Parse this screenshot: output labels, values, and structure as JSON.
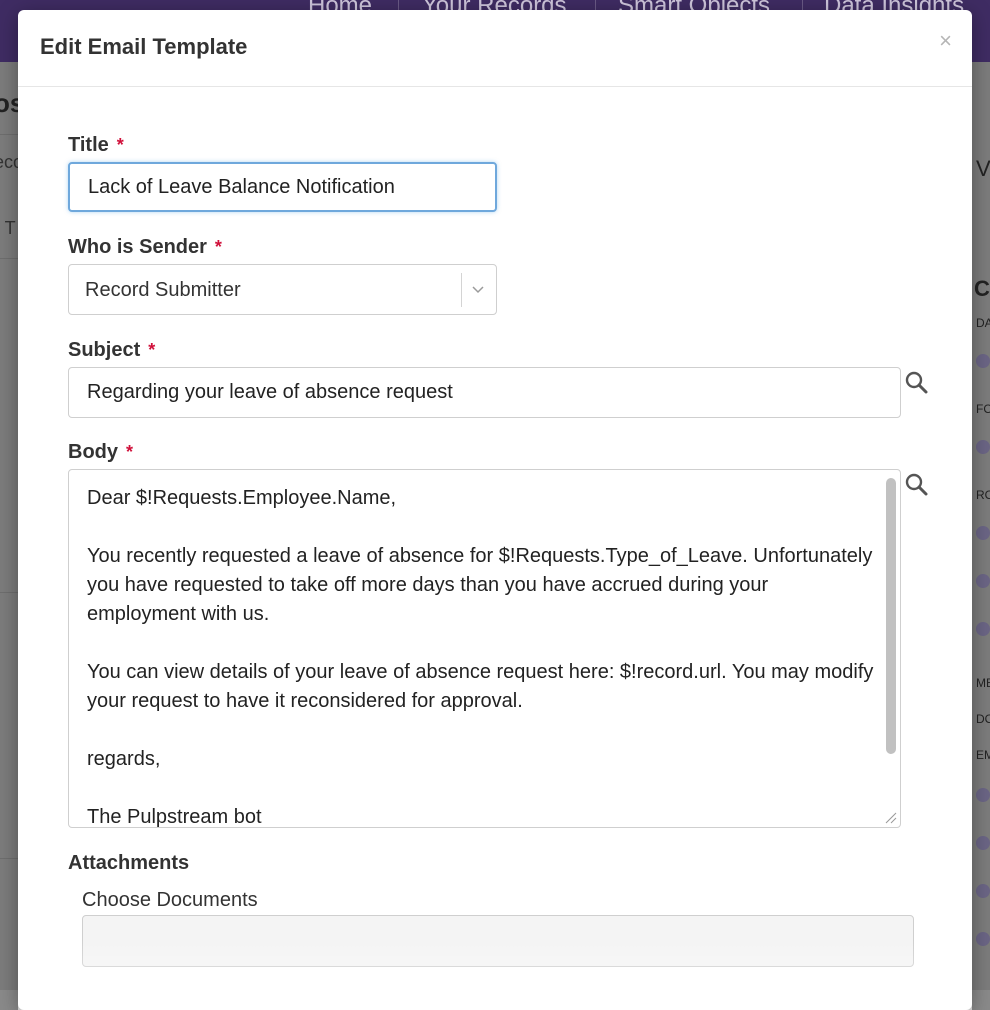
{
  "background": {
    "nav_items": [
      "Home",
      "Your Records",
      "Smart Objects",
      "Data Insights"
    ],
    "fragments": [
      "os",
      "eco",
      "r T",
      "V",
      "Co",
      "DA",
      "FO",
      "RO",
      "ME",
      "DO",
      "EM"
    ]
  },
  "modal": {
    "title": "Edit Email Template",
    "close_symbol": "×",
    "required_marker": "*",
    "fields": {
      "title": {
        "label": "Title",
        "value": "Lack of Leave Balance Notification"
      },
      "sender": {
        "label": "Who is Sender",
        "value": "Record Submitter"
      },
      "subject": {
        "label": "Subject",
        "value": "Regarding your leave of absence request"
      },
      "body": {
        "label": "Body",
        "paragraphs": [
          "Dear $!Requests.Employee.Name,",
          "You recently requested a leave of absence for $!Requests.Type_of_Leave. Unfortunately you have requested to take off more days than you have accrued during your employment with us.",
          "You can view details of your leave of absence request here: $!record.url. You may modify your request to have it reconsidered for approval.",
          "regards,",
          "The Pulpstream bot"
        ]
      }
    },
    "attachments": {
      "label": "Attachments",
      "choose_label": "Choose Documents"
    }
  },
  "colors": {
    "nav_bg": "#3f2c63",
    "required": "#d0103a",
    "focus_border": "#6fa8dc"
  },
  "icons": {
    "close": "close-icon",
    "select": "chevron-down-icon",
    "lookup": "search-icon"
  }
}
